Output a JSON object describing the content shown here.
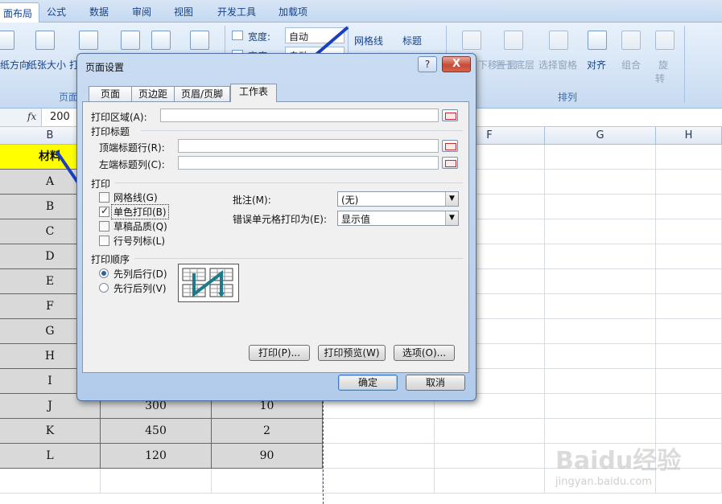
{
  "ribbon_tabs": [
    "面布局",
    "公式",
    "数据",
    "审阅",
    "视图",
    "开发工具",
    "加载项"
  ],
  "ribbon": {
    "buttons": [
      "纸方向",
      "纸张大小",
      "打",
      "宽度:",
      "网格线",
      "标题",
      "高度:"
    ],
    "width_value": "自动",
    "height_value": "自动",
    "arrange": [
      "上移一层",
      "下移一层",
      "置于顶层",
      "置于底层",
      "选择窗格",
      "对齐",
      "组合",
      "旋",
      "转"
    ],
    "groups": [
      "页面",
      "排列"
    ]
  },
  "formula_bar": {
    "fx": "fx",
    "value": "200"
  },
  "columns": [
    "B",
    "F",
    "G",
    "H"
  ],
  "sheet": {
    "header": "材料",
    "rows": [
      {
        "label": "A",
        "c": "",
        "d": ""
      },
      {
        "label": "B",
        "c": "",
        "d": ""
      },
      {
        "label": "C",
        "c": "",
        "d": ""
      },
      {
        "label": "D",
        "c": "",
        "d": ""
      },
      {
        "label": "E",
        "c": "",
        "d": ""
      },
      {
        "label": "F",
        "c": "",
        "d": ""
      },
      {
        "label": "G",
        "c": "",
        "d": ""
      },
      {
        "label": "H",
        "c": "",
        "d": ""
      },
      {
        "label": "I",
        "c": "",
        "d": ""
      },
      {
        "label": "J",
        "c": "300",
        "d": "10"
      },
      {
        "label": "K",
        "c": "450",
        "d": "2"
      },
      {
        "label": "L",
        "c": "120",
        "d": "90"
      }
    ]
  },
  "dialog": {
    "title": "页面设置",
    "help": "?",
    "close": "X",
    "tabs": [
      "页面",
      "页边距",
      "页眉/页脚",
      "工作表"
    ],
    "print_area_label": "打印区域(A):",
    "print_titles_label": "打印标题",
    "top_rows_label": "顶端标题行(R):",
    "left_cols_label": "左端标题列(C):",
    "print_section_label": "打印",
    "checkboxes": [
      {
        "label": "网格线(G)",
        "checked": false
      },
      {
        "label": "单色打印(B)",
        "checked": true
      },
      {
        "label": "草稿品质(Q)",
        "checked": false
      },
      {
        "label": "行号列标(L)",
        "checked": false
      }
    ],
    "comments_label": "批注(M):",
    "comments_value": "(无)",
    "errors_label": "错误单元格打印为(E):",
    "errors_value": "显示值",
    "order_label": "打印顺序",
    "order_options": [
      {
        "label": "先列后行(D)",
        "selected": true
      },
      {
        "label": "先行后列(V)",
        "selected": false
      }
    ],
    "buttons": {
      "print": "打印(P)...",
      "preview": "打印预览(W)",
      "options": "选项(O)...",
      "ok": "确定",
      "cancel": "取消"
    }
  },
  "watermark": {
    "brand": "Baidu经验",
    "url": "jingyan.baidu.com"
  },
  "colors": {
    "header_yellow": "#ffff00",
    "cell_gray": "#d9d9d9",
    "arrow": "#1a3fbf",
    "ribbon_text": "#15428b"
  }
}
